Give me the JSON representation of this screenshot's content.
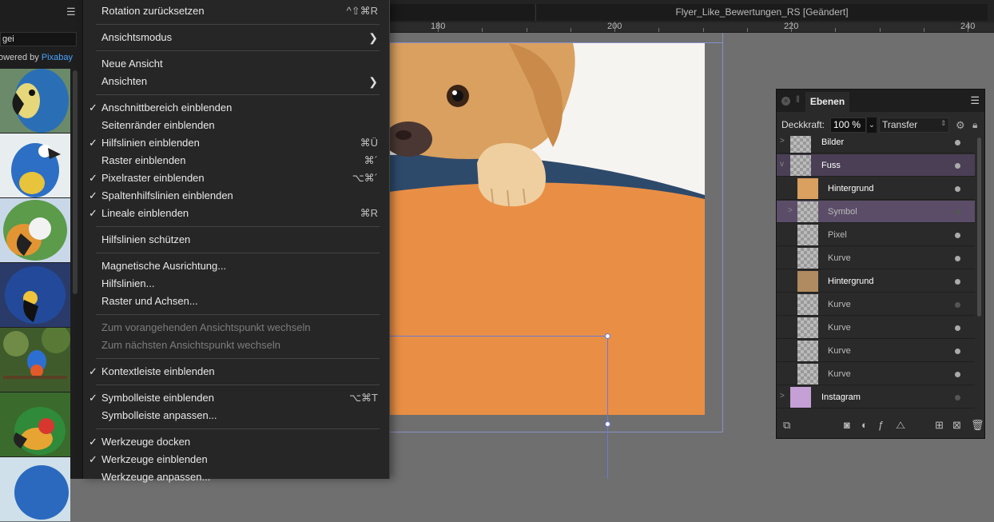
{
  "stock": {
    "search_value": "gei",
    "powered_prefix": "owered by ",
    "powered_brand": "Pixabay"
  },
  "document": {
    "title": "Flyer_Like_Bewertungen_RS [Geändert]"
  },
  "ruler": {
    "labels": [
      "180",
      "200",
      "220",
      "240"
    ]
  },
  "menu": {
    "items": [
      {
        "label": "Rotation zurücksetzen",
        "shortcut": "^⇧⌘R",
        "checked": false
      },
      {
        "label": "Ansichtsmodus",
        "submenu": true
      },
      {
        "label": "Neue Ansicht"
      },
      {
        "label": "Ansichten",
        "submenu": true
      },
      {
        "label": "Anschnittbereich einblenden",
        "checked": true
      },
      {
        "label": "Seitenränder einblenden"
      },
      {
        "label": "Hilfslinien einblenden",
        "checked": true,
        "shortcut": "⌘Ü"
      },
      {
        "label": "Raster einblenden",
        "shortcut": "⌘´"
      },
      {
        "label": "Pixelraster einblenden",
        "checked": true,
        "shortcut": "⌥⌘´"
      },
      {
        "label": "Spaltenhilfslinien einblenden",
        "checked": true
      },
      {
        "label": "Lineale einblenden",
        "checked": true,
        "shortcut": "⌘R"
      },
      {
        "label": "Hilfslinien schützen"
      },
      {
        "label": "Magnetische Ausrichtung..."
      },
      {
        "label": "Hilfslinien..."
      },
      {
        "label": "Raster und Achsen..."
      },
      {
        "label": "Zum vorangehenden Ansichtspunkt wechseln",
        "disabled": true
      },
      {
        "label": "Zum nächsten Ansichtspunkt wechseln",
        "disabled": true
      },
      {
        "label": "Kontextleiste einblenden",
        "checked": true
      },
      {
        "label": "Symbolleiste einblenden",
        "checked": true,
        "shortcut": "⌥⌘T"
      },
      {
        "label": "Symbolleiste anpassen..."
      },
      {
        "label": "Werkzeuge docken",
        "checked": true
      },
      {
        "label": "Werkzeuge einblenden",
        "checked": true
      },
      {
        "label": "Werkzeuge anpassen..."
      }
    ],
    "check_glyph": "✓",
    "submenu_glyph": "❯"
  },
  "layers": {
    "tab_label": "Ebenen",
    "opacity_label": "Deckkraft:",
    "opacity_value": "100 %",
    "blend_mode": "Transfer",
    "rows": [
      {
        "name": "Bilder",
        "level": 0,
        "expander": ">"
      },
      {
        "name": "Fuss",
        "level": 0,
        "expander": "v"
      },
      {
        "name": "Hintergrund",
        "level": 1
      },
      {
        "name": "Symbol",
        "level": 1,
        "expander": ">"
      },
      {
        "name": "Pixel",
        "level": 1
      },
      {
        "name": "Kurve",
        "level": 1
      },
      {
        "name": "Hintergrund",
        "level": 1
      },
      {
        "name": "Kurve",
        "level": 1
      },
      {
        "name": "Kurve",
        "level": 1
      },
      {
        "name": "Kurve",
        "level": 1
      },
      {
        "name": "Kurve",
        "level": 1
      },
      {
        "name": "Instagram",
        "level": 0,
        "expander": ">"
      }
    ]
  },
  "colors": {
    "artboard_orange": "#e98f45",
    "wave_navy": "#2e4a6b",
    "selected_layer": "#4a3f55",
    "accent_link": "#4aa3ff"
  }
}
